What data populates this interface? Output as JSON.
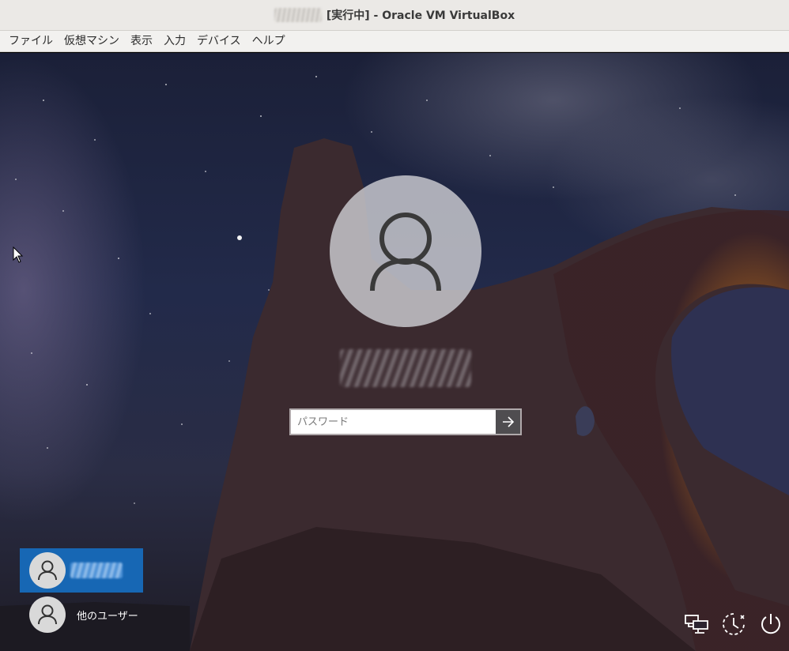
{
  "window": {
    "title": "[実行中] - Oracle VM VirtualBox"
  },
  "menu": {
    "items": [
      "ファイル",
      "仮想マシン",
      "表示",
      "入力",
      "デバイス",
      "ヘルプ"
    ]
  },
  "login": {
    "password_placeholder": "パスワード",
    "password_value": "",
    "submit_icon": "arrow-right-icon",
    "avatar_icon": "user-icon"
  },
  "user_list": {
    "other_user_label": "他のユーザー"
  },
  "system_buttons": {
    "network_icon": "network-icon",
    "accessibility_icon": "ease-of-access-icon",
    "power_icon": "power-icon"
  },
  "colors": {
    "selected_user": "#1767b4",
    "submit_button": "#4f4d50",
    "titlebar": "#ebe9e6",
    "menubar": "#f2f1ef"
  }
}
